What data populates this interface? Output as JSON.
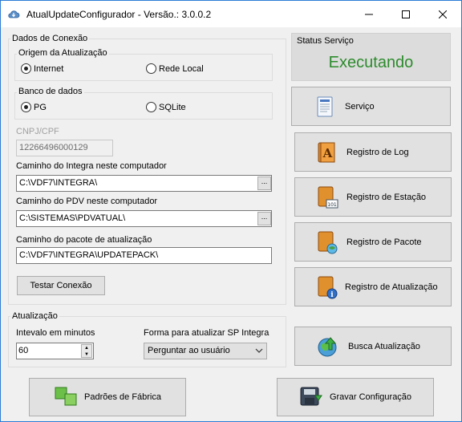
{
  "window": {
    "title": "AtualUpdateConfigurador - Versão.: 3.0.0.2"
  },
  "conexao": {
    "legend": "Dados de Conexão",
    "origem": {
      "legend": "Origem da Atualização",
      "options": [
        "Internet",
        "Rede Local"
      ],
      "selected": "Internet"
    },
    "banco": {
      "legend": "Banco de dados",
      "options": [
        "PG",
        "SQLite"
      ],
      "selected": "PG"
    },
    "cnpj_label": "CNPJ/CPF",
    "cnpj_value": "12266496000129",
    "integra_label": "Caminho do Integra neste computador",
    "integra_value": "C:\\VDF7\\INTEGRA\\",
    "pdv_label": "Caminho do PDV neste computador",
    "pdv_value": "C:\\SISTEMAS\\PDVATUAL\\",
    "pacote_label": "Caminho do pacote de atualização",
    "pacote_value": "C:\\VDF7\\INTEGRA\\UPDATEPACK\\",
    "browse_label": "...",
    "testar_label": "Testar Conexão"
  },
  "status": {
    "title": "Status Serviço",
    "value": "Executando",
    "color": "#2d8b2d"
  },
  "side_buttons": {
    "servico": "Serviço",
    "log": "Registro de Log",
    "estacao": "Registro de Estação",
    "pacote": "Registro de Pacote",
    "atualizacao": "Registro de Atualização",
    "busca": "Busca Atualização"
  },
  "atualizacao": {
    "legend": "Atualização",
    "intervalo_label": "Intevalo em minutos",
    "intervalo_value": "60",
    "forma_label": "Forma para atualizar SP Integra",
    "forma_value": "Perguntar ao usuário"
  },
  "bottom": {
    "padroes": "Padrões de Fábrica",
    "gravar": "Gravar Configuração"
  }
}
